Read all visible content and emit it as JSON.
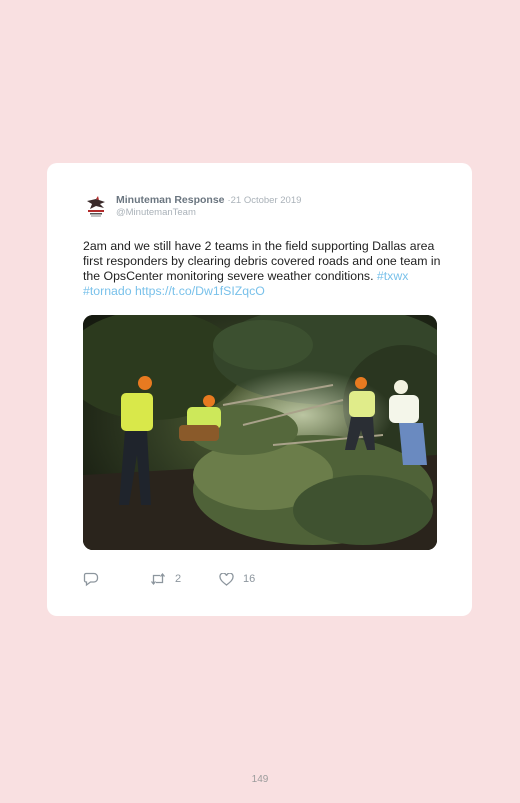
{
  "tweet": {
    "display_name": "Minuteman Response",
    "separator": "·",
    "date": "21 October 2019",
    "handle": "@MinutemanTeam",
    "text_body": "2am and we still have 2 teams in the field supporting Dallas area first responders by clearing debris covered roads and one team in the OpsCenter monitoring severe weather conditions.",
    "hashtag_1": "#txwx",
    "hashtag_2": "#tornado",
    "url": "https://t.co/Dw1fSIZqcO",
    "photo_alt": "Crew members in hard hats and hi-vis shirts clearing a fallen tree at night",
    "avatar_icon": "minuteman-logo-icon"
  },
  "actions": {
    "reply_icon": "reply-icon",
    "retweet_icon": "retweet-icon",
    "retweet_count": "2",
    "like_icon": "heart-icon",
    "like_count": "16"
  },
  "page": {
    "number": "149"
  },
  "colors": {
    "page_background": "#f9e0e1",
    "card_background": "#ffffff",
    "link": "#79c1ea",
    "name": "#6b7680",
    "muted": "#aab2b9"
  }
}
